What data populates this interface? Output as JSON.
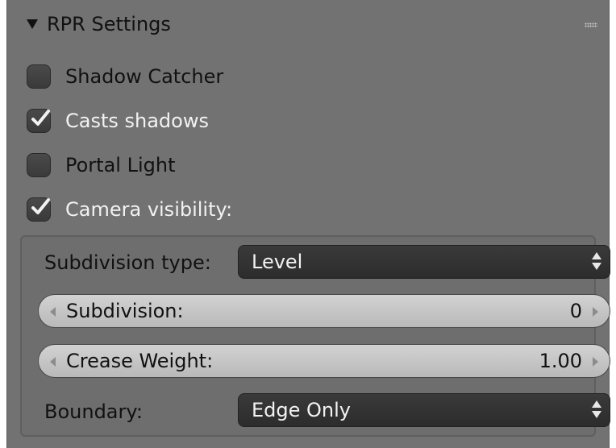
{
  "panel": {
    "title": "RPR Settings",
    "checkboxes": [
      {
        "label": "Shadow Catcher",
        "checked": false
      },
      {
        "label": "Casts shadows",
        "checked": true
      },
      {
        "label": "Portal Light",
        "checked": false
      },
      {
        "label": "Camera visibility:",
        "checked": true
      }
    ],
    "subdivision_type": {
      "label": "Subdivision type:",
      "value": "Level"
    },
    "subdivision": {
      "label": "Subdivision:",
      "value": "0"
    },
    "crease_weight": {
      "label": "Crease Weight:",
      "value": "1.00"
    },
    "boundary": {
      "label": "Boundary:",
      "value": "Edge Only"
    }
  },
  "colors": {
    "panel_bg": "#727272",
    "dropdown_bg": "#2c2c2c",
    "numfield_bg": "#c6c6c6",
    "checkbox_bg": "#3f3f3f"
  }
}
